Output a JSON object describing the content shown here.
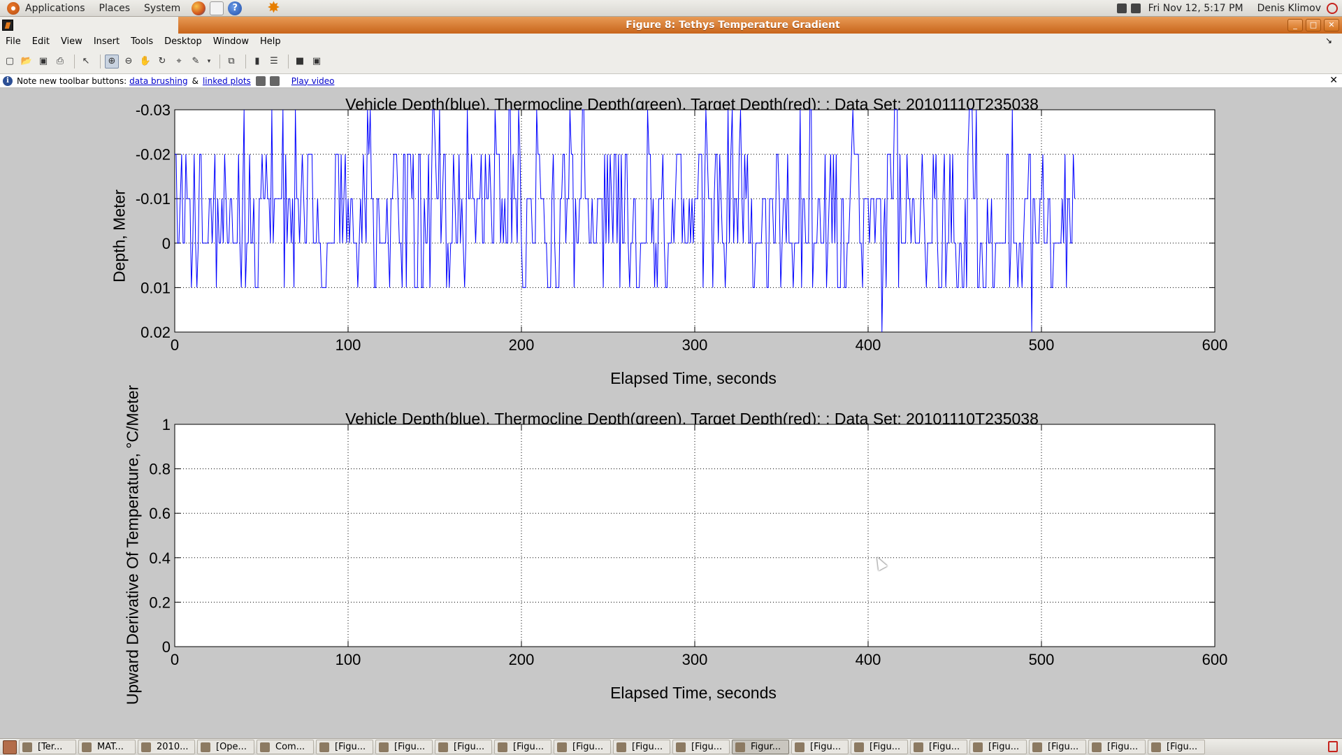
{
  "top_panel": {
    "menus": [
      "Applications",
      "Places",
      "System"
    ],
    "clock": "Fri Nov 12,  5:17 PM",
    "user": "Denis Klimov"
  },
  "window": {
    "title": "Figure 8: Tethys Temperature Gradient"
  },
  "menubar": {
    "items": [
      "File",
      "Edit",
      "View",
      "Insert",
      "Tools",
      "Desktop",
      "Window",
      "Help"
    ]
  },
  "toolbar": {
    "buttons": [
      "new-figure-icon",
      "open-file-icon",
      "save-icon",
      "print-icon",
      "select-arrow-icon",
      "zoom-in-icon",
      "zoom-out-icon",
      "pan-hand-icon",
      "rotate-3d-icon",
      "data-cursor-icon",
      "brush-icon",
      "link-plot-icon",
      "colorbar-icon",
      "legend-icon",
      "hide-tools-icon",
      "show-tools-icon"
    ]
  },
  "infobar": {
    "text": "Note new toolbar buttons:",
    "link1": "data brushing",
    "amp": "&",
    "link2": "linked plots",
    "link3": "Play video"
  },
  "chart_data": [
    {
      "type": "line",
      "title": "Vehicle Depth(blue), Thermocline Depth(green), Target Depth(red): ; Data Set: 20101110T235038",
      "xlabel": "Elapsed Time,  seconds",
      "ylabel": "Depth, Meter",
      "xlim": [
        0,
        600
      ],
      "ylim": [
        -0.03,
        0.02
      ],
      "y_reversed": true,
      "grid": true,
      "xticks": [
        "0",
        "100",
        "200",
        "300",
        "400",
        "500",
        "600"
      ],
      "yticks": [
        "-0.03",
        "-0.02",
        "-0.01",
        "0",
        "0.01",
        "0.02"
      ],
      "series": [
        {
          "color": "#0000ff",
          "note": "Noisy quantized depth signal from 0 to ~520 s, values in {-0.03,-0.02,-0.01,0,0.01,0.02}",
          "x_start": 0,
          "x_end": 520,
          "levels": [
            -0.03,
            -0.02,
            -0.01,
            0,
            0.01,
            0.02
          ]
        }
      ]
    },
    {
      "type": "line",
      "title": "Vehicle Depth(blue), Thermocline Depth(green), Target Depth(red): ; Data Set: 20101110T235038",
      "xlabel": "Elapsed Time,  seconds",
      "ylabel": "Upward Derivative Of Temperature, °C/Meter",
      "xlim": [
        0,
        600
      ],
      "ylim": [
        0,
        1
      ],
      "grid": true,
      "xticks": [
        "0",
        "100",
        "200",
        "300",
        "400",
        "500",
        "600"
      ],
      "yticks": [
        "0",
        "0.2",
        "0.4",
        "0.6",
        "0.8",
        "1"
      ],
      "series": []
    }
  ],
  "taskbar": {
    "tasks": [
      "[Ter...",
      "MAT...",
      "2010...",
      "[Ope...",
      "Com...",
      "[Figu...",
      "[Figu...",
      "[Figu...",
      "[Figu...",
      "[Figu...",
      "[Figu...",
      "[Figu...",
      "Figur...",
      "[Figu...",
      "[Figu...",
      "[Figu...",
      "[Figu...",
      "[Figu...",
      "[Figu...",
      "[Figu..."
    ],
    "active_index": 12
  }
}
